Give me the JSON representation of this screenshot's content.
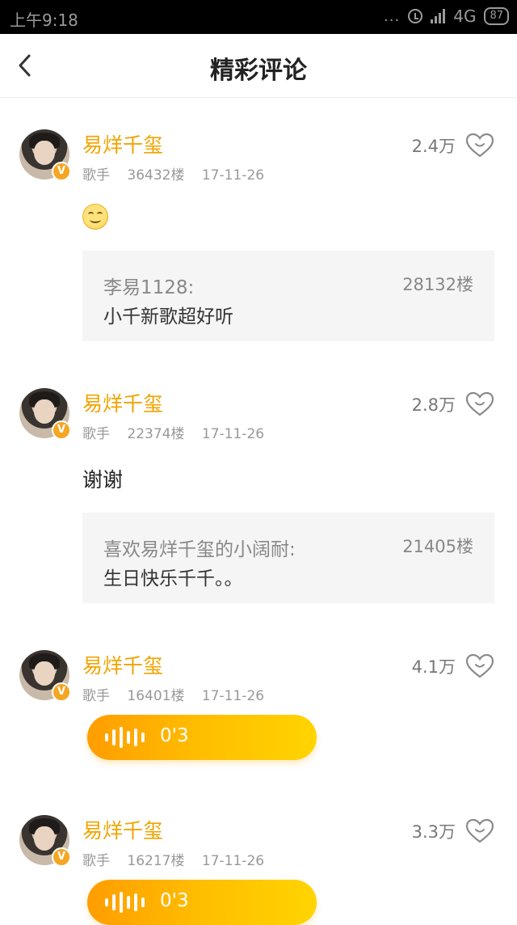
{
  "status_bar": {
    "time": "上午9:18",
    "dots": "...",
    "network": "4G",
    "battery": "87"
  },
  "header": {
    "title": "精彩评论"
  },
  "comments": [
    {
      "name": "易烊千玺",
      "role": "歌手",
      "floor": "36432楼",
      "date": "17-11-26",
      "likes": "2.4万",
      "content_type": "emoji",
      "reply": {
        "name": "李易1128:",
        "floor": "28132楼",
        "text": "小千新歌超好听"
      }
    },
    {
      "name": "易烊千玺",
      "role": "歌手",
      "floor": "22374楼",
      "date": "17-11-26",
      "likes": "2.8万",
      "content_type": "text",
      "text": "谢谢",
      "reply": {
        "name": "喜欢易烊千玺的小阔耐:",
        "floor": "21405楼",
        "text": "生日快乐千千。。"
      }
    },
    {
      "name": "易烊千玺",
      "role": "歌手",
      "floor": "16401楼",
      "date": "17-11-26",
      "likes": "4.1万",
      "content_type": "voice",
      "voice_duration": "0'3"
    },
    {
      "name": "易烊千玺",
      "role": "歌手",
      "floor": "16217楼",
      "date": "17-11-26",
      "likes": "3.3万",
      "content_type": "voice",
      "voice_duration": "0'3"
    }
  ],
  "colors": {
    "accent": "#f0a400",
    "voice_start": "#ff9d00",
    "voice_end": "#ffd400",
    "reply_bg": "#f5f5f5"
  }
}
